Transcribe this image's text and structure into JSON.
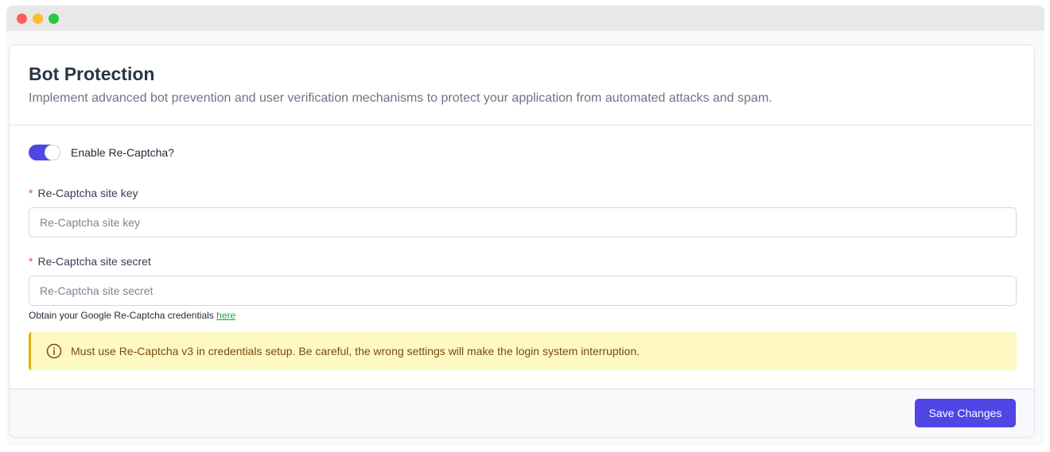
{
  "card": {
    "title": "Bot Protection",
    "description": "Implement advanced bot prevention and user verification mechanisms to protect your application from automated attacks and spam."
  },
  "toggle": {
    "label": "Enable Re-Captcha?",
    "enabled": true
  },
  "fields": {
    "site_key": {
      "required_mark": "*",
      "label": "Re-Captcha site key",
      "placeholder": "Re-Captcha site key",
      "value": ""
    },
    "site_secret": {
      "required_mark": "*",
      "label": "Re-Captcha site secret",
      "placeholder": "Re-Captcha site secret",
      "value": ""
    }
  },
  "hint": {
    "text": "Obtain your Google Re-Captcha credentials ",
    "link_label": "here"
  },
  "alert": {
    "icon": "info-circle-icon",
    "text": "Must use Re-Captcha v3 in credentials setup. Be careful, the wrong settings will make the login system interruption."
  },
  "footer": {
    "save_label": "Save Changes"
  },
  "colors": {
    "accent": "#4f46e5",
    "alert_bg": "#fef9c3",
    "alert_border": "#e3b10c",
    "link": "#16a34a",
    "required": "#e5484d"
  }
}
